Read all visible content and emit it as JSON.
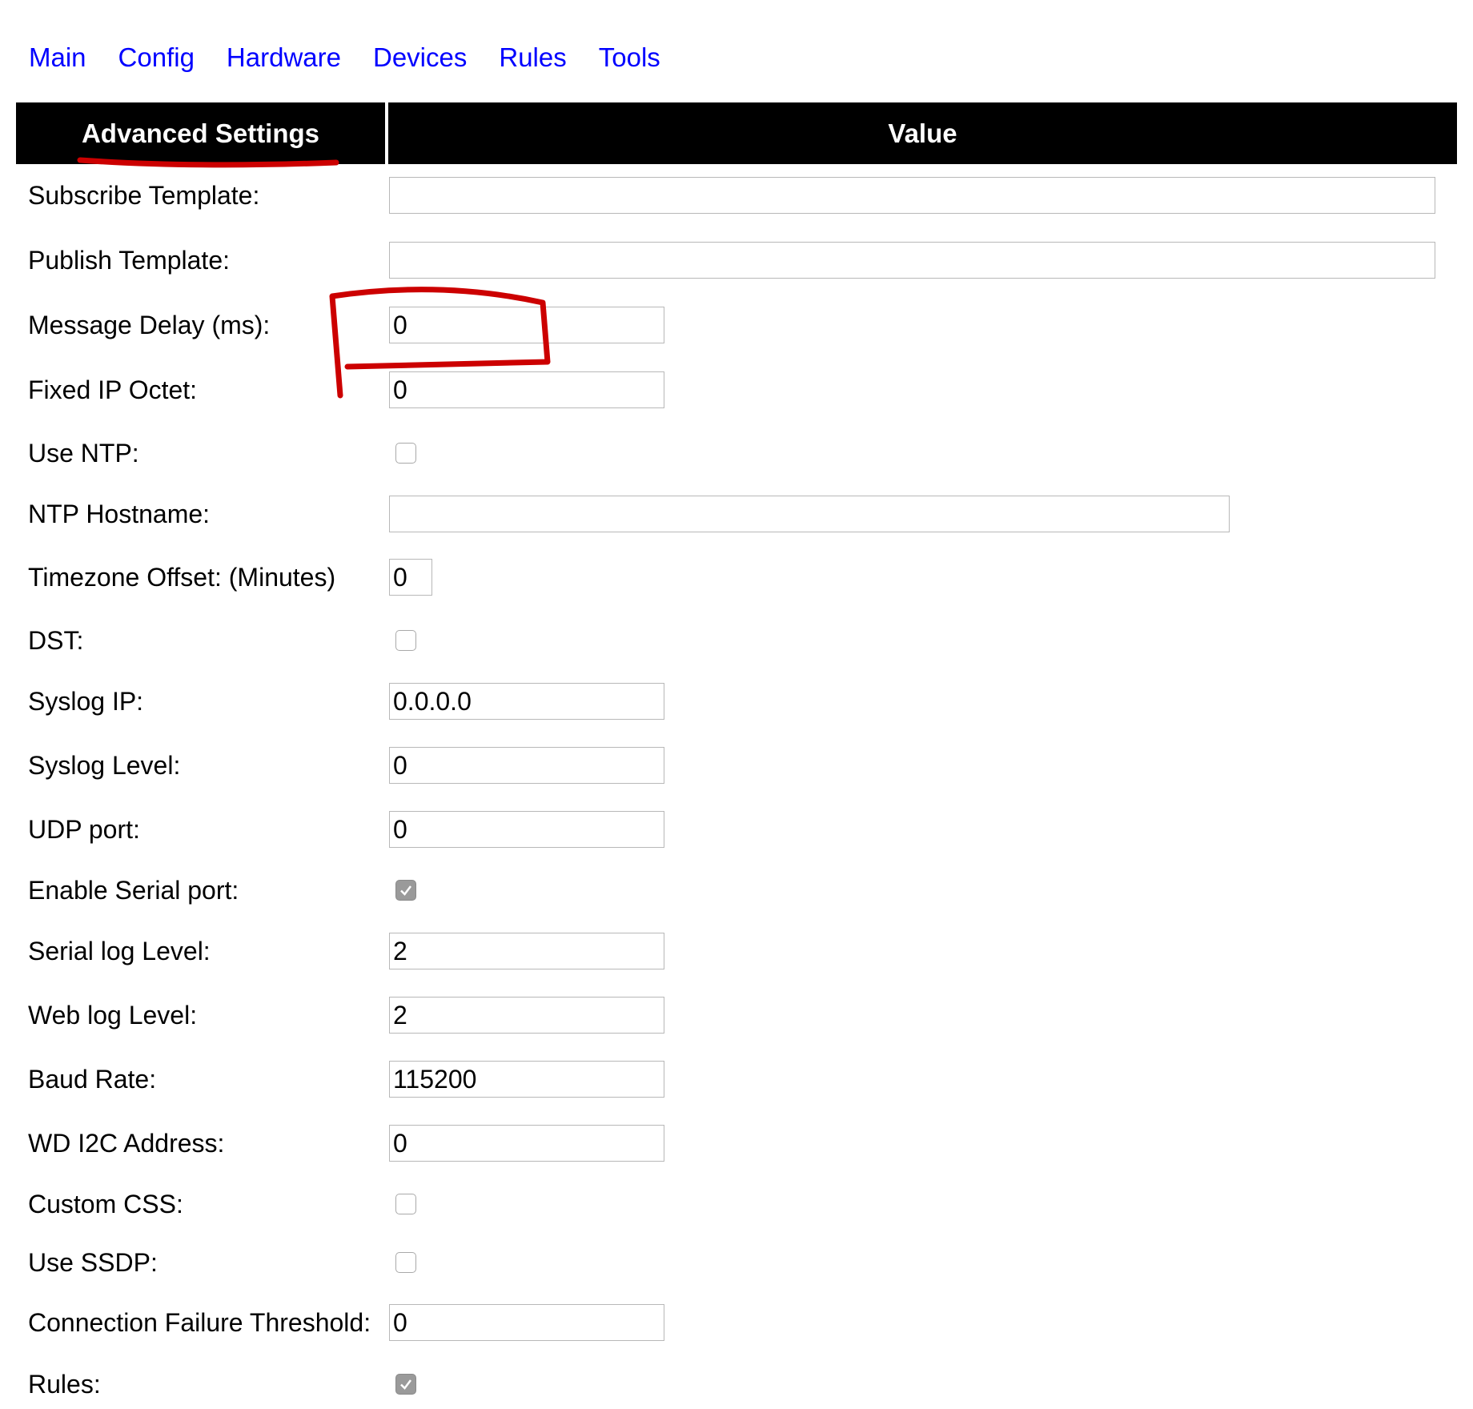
{
  "nav": {
    "items": [
      "Main",
      "Config",
      "Hardware",
      "Devices",
      "Rules",
      "Tools"
    ]
  },
  "table": {
    "header_left": "Advanced Settings",
    "header_right": "Value"
  },
  "fields": {
    "subscribe_template": {
      "label": "Subscribe Template:",
      "value": ""
    },
    "publish_template": {
      "label": "Publish Template:",
      "value": ""
    },
    "message_delay": {
      "label": "Message Delay (ms):",
      "value": "0"
    },
    "fixed_ip_octet": {
      "label": "Fixed IP Octet:",
      "value": "0"
    },
    "use_ntp": {
      "label": "Use NTP:",
      "checked": false
    },
    "ntp_hostname": {
      "label": "NTP Hostname:",
      "value": ""
    },
    "timezone_offset": {
      "label": "Timezone Offset: (Minutes)",
      "value": "0"
    },
    "dst": {
      "label": "DST:",
      "checked": false
    },
    "syslog_ip": {
      "label": "Syslog IP:",
      "value": "0.0.0.0"
    },
    "syslog_level": {
      "label": "Syslog Level:",
      "value": "0"
    },
    "udp_port": {
      "label": "UDP port:",
      "value": "0"
    },
    "enable_serial_port": {
      "label": "Enable Serial port:",
      "checked": true
    },
    "serial_log_level": {
      "label": "Serial log Level:",
      "value": "2"
    },
    "web_log_level": {
      "label": "Web log Level:",
      "value": "2"
    },
    "baud_rate": {
      "label": "Baud Rate:",
      "value": "115200"
    },
    "wd_i2c_address": {
      "label": "WD I2C Address:",
      "value": "0"
    },
    "custom_css": {
      "label": "Custom CSS:",
      "checked": false
    },
    "use_ssdp": {
      "label": "Use SSDP:",
      "checked": false
    },
    "connection_failure_threshold": {
      "label": "Connection Failure Threshold:",
      "value": "0"
    },
    "rules": {
      "label": "Rules:",
      "checked": true
    }
  },
  "colors": {
    "link": "#0000ff",
    "header_bg": "#000000",
    "annotation": "#cc0000"
  }
}
